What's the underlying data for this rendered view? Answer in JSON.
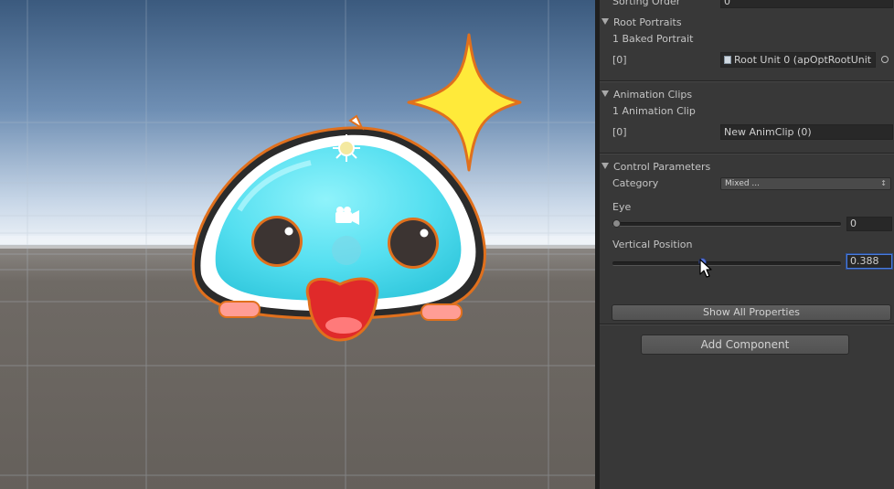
{
  "scene": {
    "colors": {
      "sky_top": "#3b5a7e",
      "sky_horizon": "#e8eef5",
      "ground": "#6b6560",
      "slime": "#5fe3f2",
      "outline": "#e0701d",
      "star": "#ffea3a"
    },
    "icons": [
      "sun-gizmo-icon",
      "camera-gizmo-icon",
      "sparkle-star"
    ]
  },
  "inspector": {
    "sorting_order": {
      "label": "Sorting Order",
      "value": "0"
    },
    "root_portraits": {
      "header": "Root Portraits",
      "count_label": "1 Baked Portrait",
      "item_index": "[0]",
      "item_value": "Root Unit 0 (apOptRootUnit",
      "item_icon": "object-field-icon"
    },
    "animation_clips": {
      "header": "Animation Clips",
      "count_label": "1 Animation Clip",
      "item_index": "[0]",
      "item_value": "New AnimClip (0)"
    },
    "control_parameters": {
      "header": "Control Parameters",
      "category_label": "Category",
      "category_value": "Mixed ...",
      "params": [
        {
          "label": "Eye",
          "value": "0",
          "fraction": 0.0
        },
        {
          "label": "Vertical Position",
          "value": "0.388",
          "fraction": 0.388
        }
      ]
    },
    "show_all_properties": "Show All Properties",
    "add_component": "Add Component"
  }
}
